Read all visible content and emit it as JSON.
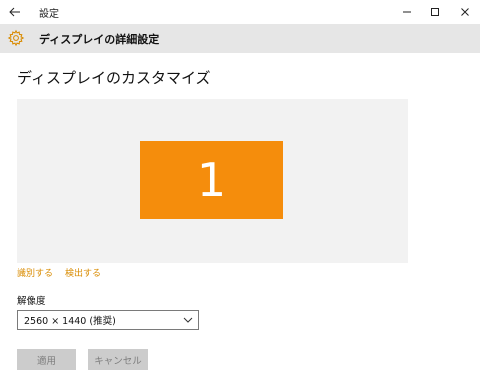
{
  "window": {
    "title": "設定"
  },
  "header": {
    "title": "ディスプレイの詳細設定",
    "icon": "gear-icon"
  },
  "page": {
    "title": "ディスプレイのカスタマイズ"
  },
  "display": {
    "monitor_number": "1",
    "monitor_color": "#f58d0c"
  },
  "links": {
    "identify": "識別する",
    "detect": "検出する"
  },
  "resolution": {
    "label": "解像度",
    "value": "2560 × 1440 (推奨)"
  },
  "buttons": {
    "apply": "適用",
    "cancel": "キャンセル"
  },
  "colors": {
    "accent": "#d98b00",
    "header_bg": "#e6e6e6"
  }
}
